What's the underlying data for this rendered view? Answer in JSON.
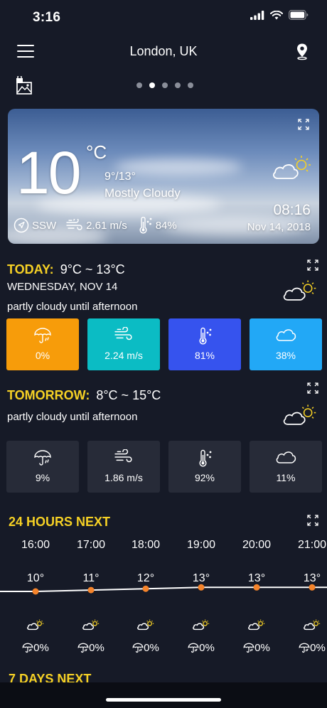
{
  "status": {
    "time": "3:16"
  },
  "header": {
    "city": "London, UK",
    "page_dots": 5,
    "active_dot": 1
  },
  "hero": {
    "temp": "10",
    "unit": "°C",
    "range": "9°/13°",
    "condition": "Mostly Cloudy",
    "wind_dir": "SSW",
    "wind_speed": "2.61 m/s",
    "humidity": "84%",
    "clock": "08:16",
    "date": "Nov 14, 2018"
  },
  "today": {
    "label": "TODAY:",
    "range": "9°C ~ 13°C",
    "weekday": "WEDNESDAY, NOV 14",
    "summary": "partly cloudy until afternoon",
    "tiles": [
      {
        "icon": "umbrella-icon",
        "value": "0%",
        "color": "#f79c0a"
      },
      {
        "icon": "wind-icon",
        "value": "2.24 m/s",
        "color": "#0bbcc4"
      },
      {
        "icon": "thermometer-icon",
        "value": "81%",
        "color": "#3653ee"
      },
      {
        "icon": "cloud-icon",
        "value": "38%",
        "color": "#22a8f6"
      }
    ]
  },
  "tomorrow": {
    "label": "TOMORROW:",
    "range": "8°C ~ 15°C",
    "summary": "partly cloudy until afternoon",
    "tiles": [
      {
        "icon": "umbrella-icon",
        "value": "9%",
        "color": "#272b38"
      },
      {
        "icon": "wind-icon",
        "value": "1.86 m/s",
        "color": "#272b38"
      },
      {
        "icon": "thermometer-icon",
        "value": "92%",
        "color": "#272b38"
      },
      {
        "icon": "cloud-icon",
        "value": "11%",
        "color": "#272b38"
      }
    ]
  },
  "hours": {
    "title": "24 HOURS NEXT",
    "items": [
      {
        "time": "16:00",
        "temp": "10°",
        "temp_value": 10,
        "rain": "0%"
      },
      {
        "time": "17:00",
        "temp": "11°",
        "temp_value": 11,
        "rain": "0%"
      },
      {
        "time": "18:00",
        "temp": "12°",
        "temp_value": 12,
        "rain": "0%"
      },
      {
        "time": "19:00",
        "temp": "13°",
        "temp_value": 13,
        "rain": "0%"
      },
      {
        "time": "20:00",
        "temp": "13°",
        "temp_value": 13,
        "rain": "0%"
      },
      {
        "time": "21:00",
        "temp": "13°",
        "temp_value": 13,
        "rain": "0%"
      }
    ]
  },
  "week": {
    "title": "7 DAYS NEXT"
  },
  "colors": {
    "accent": "#f6d125",
    "point": "#f5842b",
    "background": "#161a27"
  }
}
